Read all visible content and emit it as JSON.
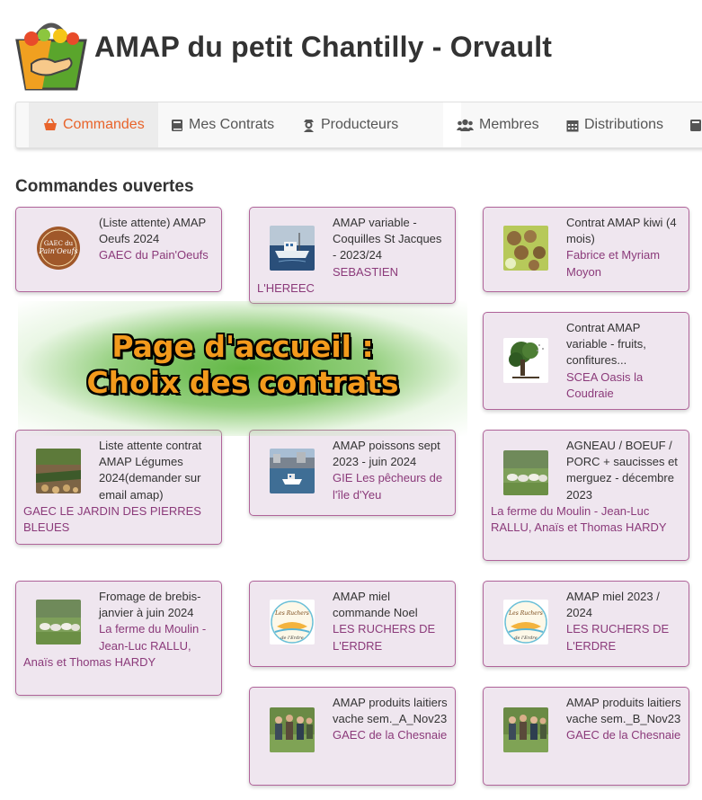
{
  "header": {
    "title": "AMAP du petit Chantilly - Orvault"
  },
  "nav": {
    "items": [
      {
        "label": "Commandes",
        "icon": "basket-icon",
        "active": true
      },
      {
        "label": "Mes Contrats",
        "icon": "book-icon"
      },
      {
        "label": "Producteurs",
        "icon": "producer-icon"
      },
      {
        "label": "Membres",
        "icon": "users-icon"
      },
      {
        "label": "Distributions",
        "icon": "calendar-icon"
      }
    ]
  },
  "main": {
    "section_title": "Commandes ouvertes",
    "cards": [
      {
        "title": "(Liste attente) AMAP Oeufs 2024",
        "producer": "GAEC du Pain'Oeufs",
        "image": "pain-oeufs-logo"
      },
      {
        "title": "AMAP variable - Coquilles St Jacques - 2023/24",
        "producer": "SEBASTIEN L'HEREEC",
        "image": "fishing-boat-photo"
      },
      {
        "title": "Contrat AMAP kiwi (4 mois)",
        "producer": "Fabrice et Myriam Moyon",
        "image": "kiwi-photo"
      },
      {
        "title": "Contrat AMAP variable - fruits, confitures...",
        "producer": "SCEA Oasis la Coudraie",
        "image": "tree-logo"
      },
      {
        "title": "Liste attente contrat AMAP Légumes 2024(demander sur email amap)",
        "producer": "GAEC LE JARDIN DES PIERRES BLEUES",
        "image": "vegetable-field-photo"
      },
      {
        "title": "AMAP poissons sept 2023 - juin 2024",
        "producer": "GIE Les pêcheurs de l'île d'Yeu",
        "image": "harbor-photo"
      },
      {
        "title": "AGNEAU / BOEUF / PORC + saucisses et merguez - décembre 2023",
        "producer": "La ferme du Moulin - Jean-Luc RALLU, Anaïs et Thomas HARDY",
        "image": "sheep-photo"
      },
      {
        "title": "Fromage de brebis- janvier à juin 2024",
        "producer": "La ferme du Moulin - Jean-Luc RALLU, Anaïs et Thomas HARDY",
        "image": "sheep-photo"
      },
      {
        "title": "AMAP miel commande Noel",
        "producer": "LES RUCHERS DE L'ERDRE",
        "image": "ruchers-logo"
      },
      {
        "title": "AMAP miel 2023 / 2024",
        "producer": "LES RUCHERS DE L'ERDRE",
        "image": "ruchers-logo"
      },
      {
        "title": "AMAP produits laitiers vache sem._A_Nov23",
        "producer": "GAEC de la Chesnaie",
        "image": "farmers-photo"
      },
      {
        "title": "AMAP produits laitiers vache sem._B_Nov23",
        "producer": "GAEC de la Chesnaie",
        "image": "farmers-photo"
      }
    ]
  },
  "banner": {
    "line1": "Page d'accueil :",
    "line2": "Choix des contrats"
  },
  "logo_text": {
    "pain_oeufs": "GAEC du Pain'Oeufs",
    "ruchers": "Les Ruchers de l'Erdre"
  }
}
